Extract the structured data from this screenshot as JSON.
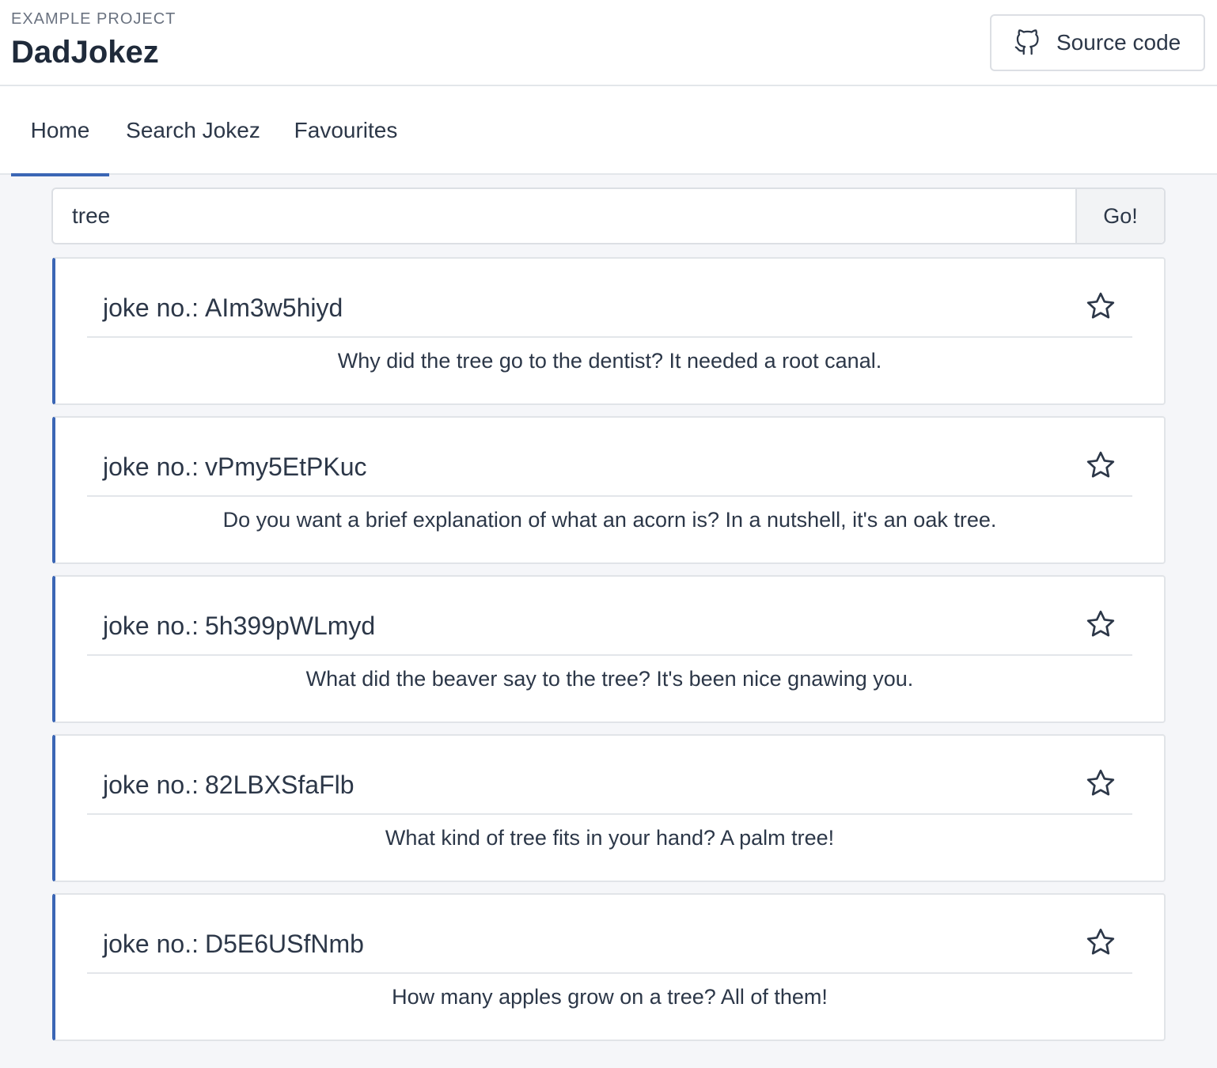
{
  "header": {
    "eyebrow": "EXAMPLE PROJECT",
    "title": "DadJokez",
    "source_label": "Source code"
  },
  "tabs": [
    {
      "label": "Home",
      "active": true
    },
    {
      "label": "Search Jokez",
      "active": false
    },
    {
      "label": "Favourites",
      "active": false
    }
  ],
  "search": {
    "value": "tree",
    "button_label": "Go!"
  },
  "joke_prefix": "joke no.:",
  "jokes": [
    {
      "id": "AIm3w5hiyd",
      "text": "Why did the tree go to the dentist? It needed a root canal."
    },
    {
      "id": "vPmy5EtPKuc",
      "text": "Do you want a brief explanation of what an acorn is? In a nutshell, it's an oak tree."
    },
    {
      "id": "5h399pWLmyd",
      "text": "What did the beaver say to the tree? It's been nice gnawing you."
    },
    {
      "id": "82LBXSfaFlb",
      "text": "What kind of tree fits in your hand? A palm tree!"
    },
    {
      "id": "D5E6USfNmb",
      "text": "How many apples grow on a tree? All of them!"
    }
  ],
  "colors": {
    "accent": "#3b66b5",
    "text": "#2c3748",
    "background": "#f5f6f9"
  },
  "icons": {
    "source": "github-icon",
    "favourite": "star-icon"
  }
}
